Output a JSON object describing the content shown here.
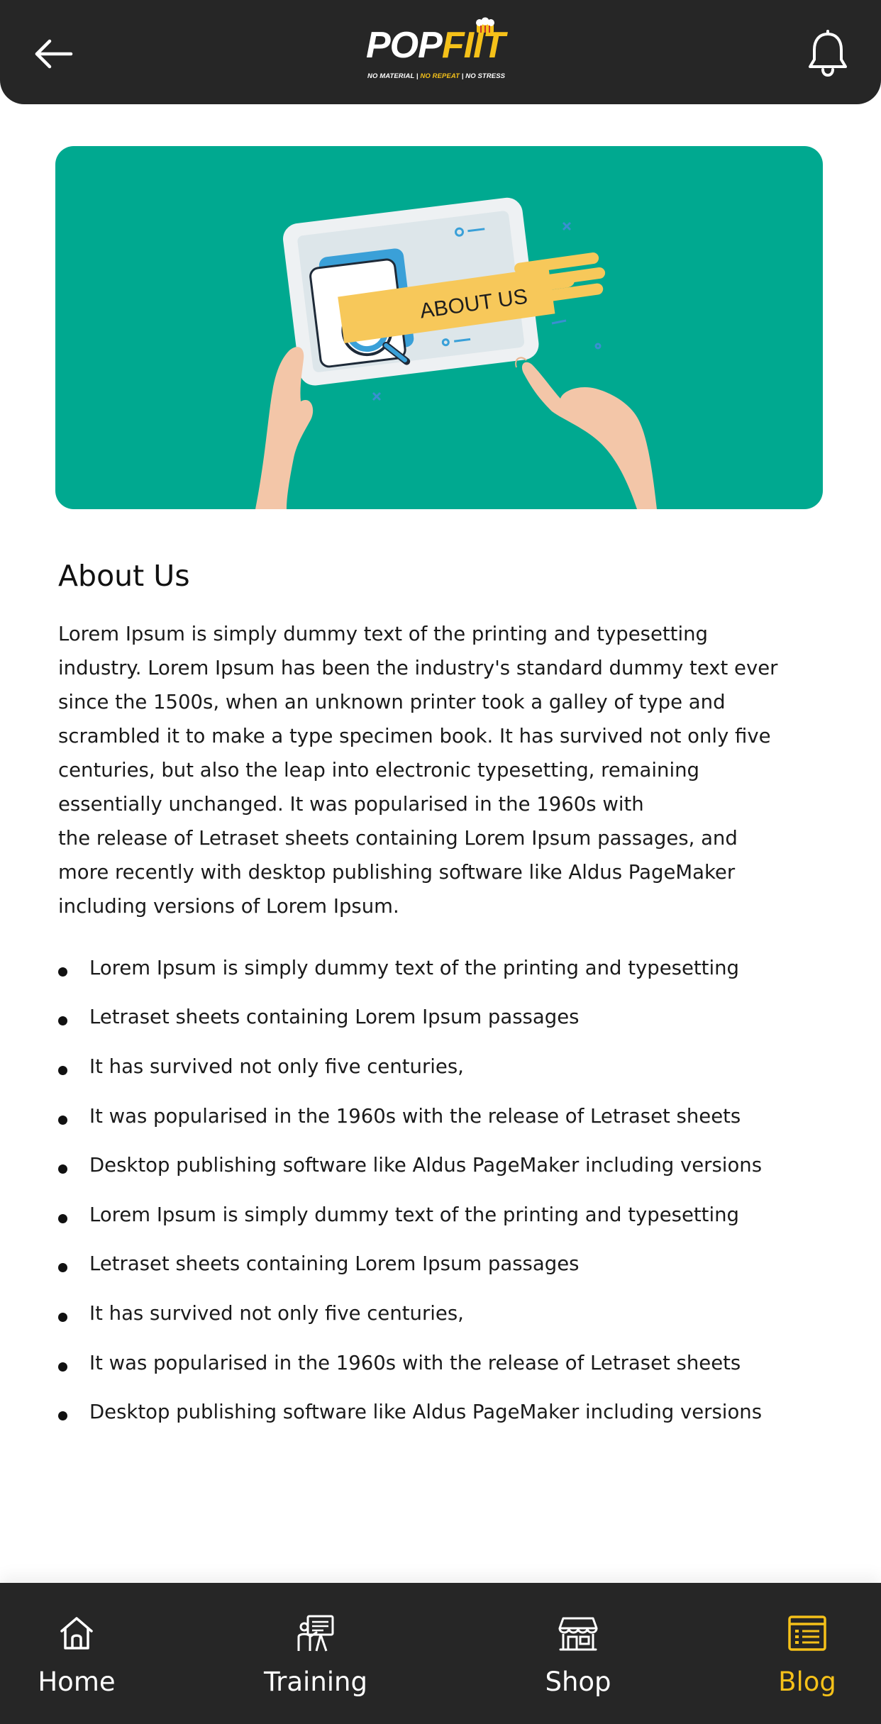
{
  "header": {
    "logo_pop": "POP",
    "logo_fiit": "FIIT",
    "logo_tag_1": "NO MATERIAL | ",
    "logo_tag_2": "NO REPEAT",
    "logo_tag_3": " | NO STRESS",
    "back_icon": "arrow-left-icon",
    "bell_icon": "bell-icon"
  },
  "hero": {
    "banner_text": "ABOUT US",
    "background_color": "#00a990",
    "banner_color": "#f7c85a"
  },
  "content": {
    "title": "About Us",
    "paragraph_lines": [
      "Lorem Ipsum is simply dummy text of the printing and typesetting",
      "industry. Lorem Ipsum has been the industry's standard dummy text ever",
      "since the 1500s, when an unknown printer took a galley of type and",
      "scrambled it to make a type specimen book. It has survived not only five",
      "centuries, but also the leap into electronic typesetting, remaining",
      "essentially unchanged. It was popularised in the 1960s with",
      "the release of Letraset sheets containing Lorem Ipsum passages, and",
      "more recently with desktop publishing software like Aldus PageMaker",
      "including versions of Lorem Ipsum."
    ],
    "bullets": [
      "Lorem Ipsum is simply dummy text of the printing and typesetting",
      "Letraset sheets containing Lorem Ipsum passages",
      "It has survived not only five centuries,",
      "It was popularised in the 1960s with the release of Letraset sheets",
      "Desktop publishing software like Aldus PageMaker including versions",
      "Lorem Ipsum is simply dummy text of the printing and typesetting",
      "Letraset sheets containing Lorem Ipsum passages",
      "It has survived not only five centuries,",
      "It was popularised in the 1960s with the release of Letraset sheets",
      "Desktop publishing software like Aldus PageMaker including versions"
    ]
  },
  "bottom_nav": {
    "items": [
      {
        "label": "Home",
        "icon": "home-icon"
      },
      {
        "label": "Training",
        "icon": "training-icon"
      },
      {
        "label": "Shop",
        "icon": "shop-icon"
      },
      {
        "label": "Blog",
        "icon": "blog-icon"
      }
    ],
    "active": "Blog",
    "active_color": "#f5c119"
  }
}
